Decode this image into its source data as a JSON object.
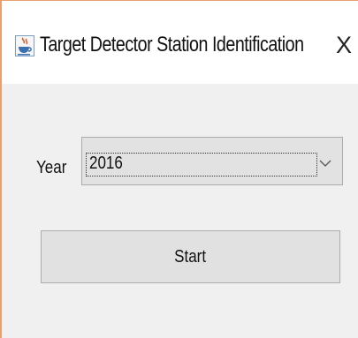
{
  "window": {
    "title": "Target Detector Station Identification",
    "close_glyph": "X",
    "icon": "java-coffee-cup-icon"
  },
  "form": {
    "year_label": "Year",
    "year_value": "2016",
    "start_label": "Start"
  },
  "colors": {
    "window_border": "#e8a070",
    "content_bg": "#f0f0f0",
    "control_bg": "#e1e1e1"
  }
}
